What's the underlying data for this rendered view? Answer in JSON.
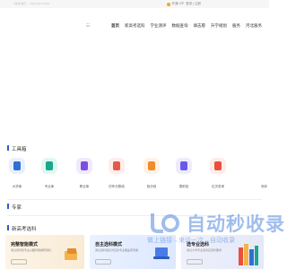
{
  "topbar": {
    "left_text": "• 联系我们 · 400-000-0000",
    "vip_label": "开通 VIP",
    "login_label": "登录 | 注册"
  },
  "nav": {
    "menu_icon": "☷",
    "items": [
      "首页",
      "新高考选科",
      "学业测评",
      "数据查询",
      "填志愿",
      "升学规划",
      "服务",
      "河北服务"
    ]
  },
  "tools_section": {
    "title": "工具箱",
    "items": [
      {
        "label": "大学库",
        "icon": "university-icon",
        "color": "#2f6fd8",
        "bg": "#e8f0ff"
      },
      {
        "label": "专业库",
        "icon": "major-icon",
        "color": "#1aa88a",
        "bg": "#e3f7f1"
      },
      {
        "label": "职业库",
        "icon": "career-icon",
        "color": "#7b4fe0",
        "bg": "#efe9ff"
      },
      {
        "label": "历年分数线",
        "icon": "score-line-icon",
        "color": "#e35a4a",
        "bg": "#ffeceb"
      },
      {
        "label": "批次线",
        "icon": "batch-line-icon",
        "color": "#f08c2a",
        "bg": "#fff2e4"
      },
      {
        "label": "提前批",
        "icon": "early-batch-icon",
        "color": "#6a58e8",
        "bg": "#eeebff"
      },
      {
        "label": "位次查询",
        "icon": "rank-query-icon",
        "color": "#e8503c",
        "bg": "#ffebe8"
      }
    ],
    "more_label": "测评"
  },
  "experts_section": {
    "title": "专家"
  },
  "xuanke_section": {
    "title": "新高考选科",
    "cards": [
      {
        "title": "完整智能模式",
        "desc": "通过测评和专业兴趣智能推荐选科"
      },
      {
        "title": "自主选科模式",
        "desc": "通过选科组合对应的专业覆盖率查看"
      },
      {
        "title": "选专业选科",
        "desc": "通过大学专业选对应选科要求"
      }
    ]
  },
  "watermark": {
    "brand": "自动秒收录",
    "slogan": "做上链接→来访一次→自动收录"
  }
}
